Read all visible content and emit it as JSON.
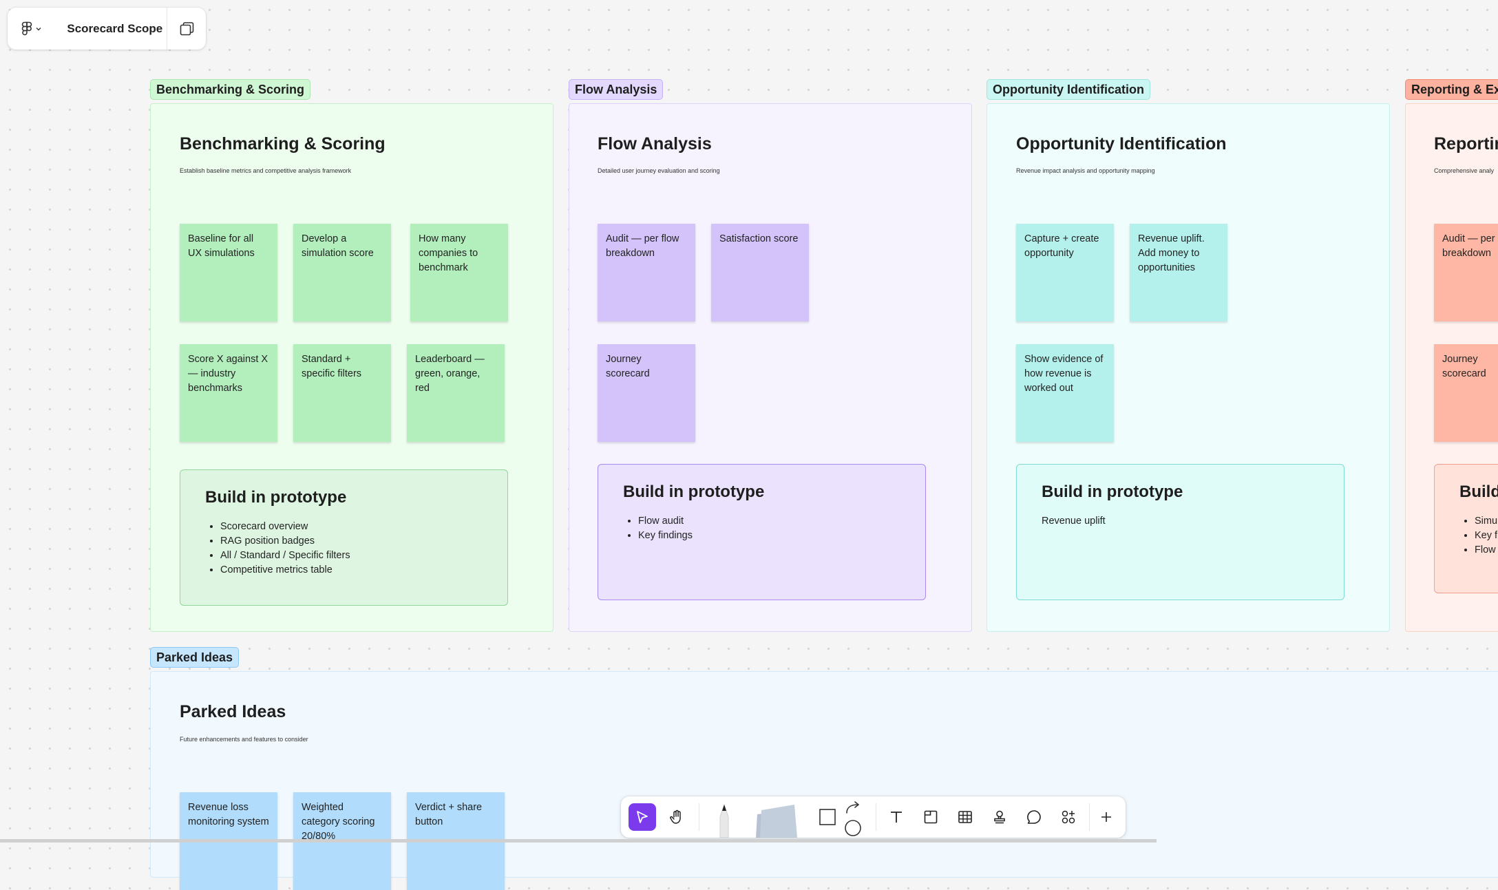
{
  "file": {
    "title": "Scorecard Scope"
  },
  "sections": {
    "benchmarking": {
      "tag": "Benchmarking & Scoring",
      "title": "Benchmarking & Scoring",
      "desc": "Establish baseline metrics and competitive analysis framework",
      "stickies": [
        "Baseline for all UX simulations",
        "Develop a simulation score",
        "How many companies to benchmark",
        "Score X against X — industry benchmarks",
        "Standard + specific filters",
        "Leaderboard — green, orange, red"
      ],
      "proto_title": "Build in prototype",
      "proto_items": [
        "Scorecard overview",
        "RAG position badges",
        "All / Standard / Specific filters",
        "Competitive metrics table"
      ]
    },
    "flow": {
      "tag": "Flow Analysis",
      "title": "Flow Analysis",
      "desc": "Detailed user journey evaluation and scoring",
      "stickies": [
        "Audit — per flow breakdown",
        "Satisfaction score",
        "Journey scorecard"
      ],
      "proto_title": "Build in prototype",
      "proto_items": [
        "Flow audit",
        "Key findings"
      ]
    },
    "opportunity": {
      "tag": "Opportunity Identification",
      "title": "Opportunity Identification",
      "desc": "Revenue impact analysis and opportunity mapping",
      "stickies": [
        "Capture + create opportunity",
        "Revenue uplift. Add money to opportunities",
        "Show evidence of how revenue is worked out"
      ],
      "proto_title": "Build in prototype",
      "proto_text": "Revenue uplift"
    },
    "reporting": {
      "tag": "Reporting & Exp",
      "title": "Reportin",
      "desc": "Comprehensive analy",
      "stickies": [
        "Audit — per breakdown",
        "Journey scorecard"
      ],
      "proto_title": "Build",
      "proto_items": [
        "Simul",
        "Key fi",
        "Flow"
      ]
    },
    "parked": {
      "tag": "Parked Ideas",
      "title": "Parked Ideas",
      "desc": "Future enhancements and features to consider",
      "stickies": [
        "Revenue loss monitoring system",
        "Weighted category scoring 20/80%",
        "Verdict + share button"
      ]
    }
  },
  "toolbar": {
    "tools": [
      "move-tool",
      "hand-tool",
      "pen-tool",
      "sticky-tool",
      "shape-tool",
      "connector-tool",
      "text-tool",
      "section-tool",
      "table-tool",
      "stamp-tool",
      "comment-tool",
      "widgets-tool",
      "more-tool"
    ],
    "active": "move-tool"
  },
  "colors": {
    "green_bg": "#edfdee",
    "green_border": "#c6efcb",
    "green_sticky": "#b3efbd",
    "green_tag": "#cff7d3",
    "purple_bg": "#f6f3fe",
    "purple_border": "#ddd3fa",
    "purple_sticky": "#d3c3fa",
    "purple_tag": "#e3d8fd",
    "teal_bg": "#effdfc",
    "teal_border": "#c6f0ec",
    "teal_sticky": "#b4f1ec",
    "teal_tag": "#c9f6f2",
    "salmon_bg": "#fff1ee",
    "salmon_sticky": "#fdb7a4",
    "salmon_tag": "#fcb29f",
    "blue_bg": "#f1f8fe",
    "blue_sticky": "#b1dcfb",
    "blue_tag": "#c6e6fd",
    "accent": "#7c3aed"
  }
}
